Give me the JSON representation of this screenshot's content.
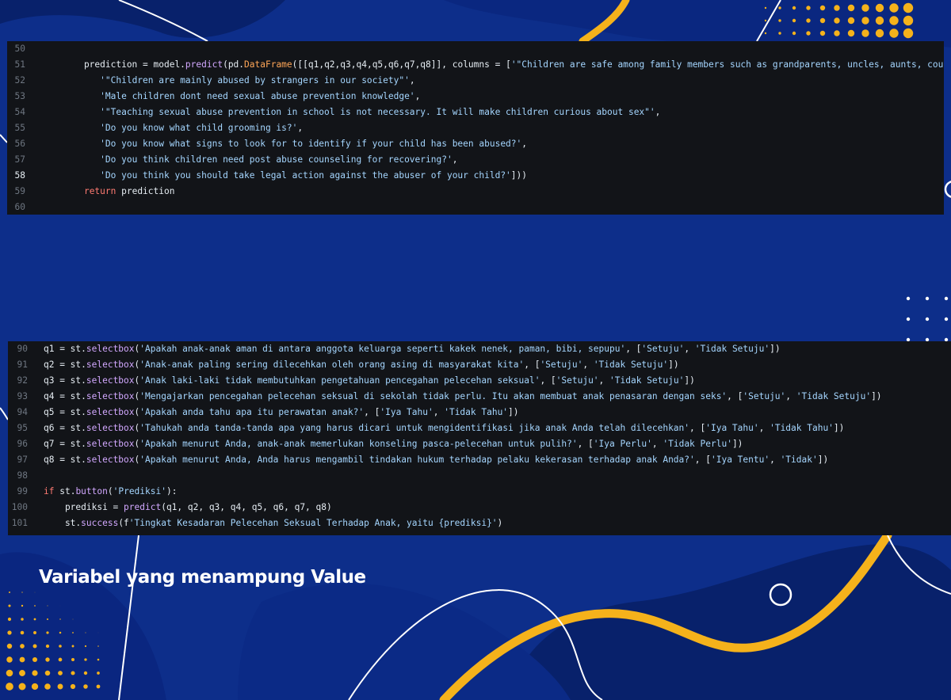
{
  "panel1": {
    "lines": [
      {
        "n": "50",
        "code": ""
      },
      {
        "n": "51",
        "code": "    prediction = model.predict(pd.DataFrame([[q1,q2,q3,q4,q5,q6,q7,q8]], columns = ['\"Children are safe among family members such as grandparents, uncles, aunts, cousins\"',"
      },
      {
        "n": "52",
        "code": "       '\"Children are mainly abused by strangers in our society\"',"
      },
      {
        "n": "53",
        "code": "       'Male children dont need sexual abuse prevention knowledge',"
      },
      {
        "n": "54",
        "code": "       '\"Teaching sexual abuse prevention in school is not necessary. It will make children curious about sex\"',"
      },
      {
        "n": "55",
        "code": "       'Do you know what child grooming is?',"
      },
      {
        "n": "56",
        "code": "       'Do you know what signs to look for to identify if your child has been abused?',"
      },
      {
        "n": "57",
        "code": "       'Do you think children need post abuse counseling for recovering?',"
      },
      {
        "n": "58",
        "code": "       'Do you think you should take legal action against the abuser of your child?']))"
      },
      {
        "n": "59",
        "code": "    return prediction"
      },
      {
        "n": "60",
        "code": ""
      }
    ],
    "active_line": "58"
  },
  "panel2": {
    "lines": [
      {
        "n": "90",
        "code": "q1 = st.selectbox('Apakah anak-anak aman di antara anggota keluarga seperti kakek nenek, paman, bibi, sepupu', ['Setuju', 'Tidak Setuju'])"
      },
      {
        "n": "91",
        "code": "q2 = st.selectbox('Anak-anak paling sering dilecehkan oleh orang asing di masyarakat kita', ['Setuju', 'Tidak Setuju'])"
      },
      {
        "n": "92",
        "code": "q3 = st.selectbox('Anak laki-laki tidak membutuhkan pengetahuan pencegahan pelecehan seksual', ['Setuju', 'Tidak Setuju'])"
      },
      {
        "n": "93",
        "code": "q4 = st.selectbox('Mengajarkan pencegahan pelecehan seksual di sekolah tidak perlu. Itu akan membuat anak penasaran dengan seks', ['Setuju', 'Tidak Setuju'])"
      },
      {
        "n": "94",
        "code": "q5 = st.selectbox('Apakah anda tahu apa itu perawatan anak?', ['Iya Tahu', 'Tidak Tahu'])"
      },
      {
        "n": "95",
        "code": "q6 = st.selectbox('Tahukah anda tanda-tanda apa yang harus dicari untuk mengidentifikasi jika anak Anda telah dilecehkan', ['Iya Tahu', 'Tidak Tahu'])"
      },
      {
        "n": "96",
        "code": "q7 = st.selectbox('Apakah menurut Anda, anak-anak memerlukan konseling pasca-pelecehan untuk pulih?', ['Iya Perlu', 'Tidak Perlu'])"
      },
      {
        "n": "97",
        "code": "q8 = st.selectbox('Apakah menurut Anda, Anda harus mengambil tindakan hukum terhadap pelaku kekerasan terhadap anak Anda?', ['Iya Tentu', 'Tidak'])"
      },
      {
        "n": "98",
        "code": ""
      },
      {
        "n": "99",
        "code": "if st.button('Prediksi'):"
      },
      {
        "n": "100",
        "code": "    prediksi = predict(q1, q2, q3, q4, q5, q6, q7, q8)"
      },
      {
        "n": "101",
        "code": "    st.success(f'Tingkat Kesadaran Pelecehan Seksual Terhadap Anak, yaitu {prediksi}')"
      }
    ]
  },
  "caption": "Variabel yang menampung Value",
  "colors": {
    "background": "#0d2e8a",
    "background_dark": "#08216b",
    "accent_yellow": "#f5b21b",
    "code_bg": "#121418",
    "keyword": "#ff7b72",
    "function": "#d2a8ff",
    "class_name": "#ffa657",
    "string": "#a5d6ff",
    "line_number": "#6e7681"
  }
}
